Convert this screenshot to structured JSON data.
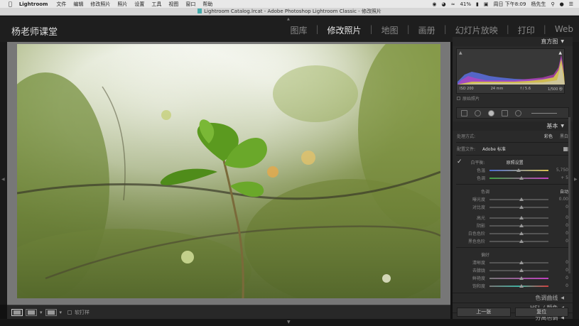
{
  "menubar": {
    "app_name": "Lightroom",
    "items": [
      "文件",
      "编辑",
      "修改照片",
      "照片",
      "设置",
      "工具",
      "视图",
      "窗口",
      "帮助"
    ],
    "battery": "41%",
    "clock": "周日 下午8:09",
    "user": "杨先生"
  },
  "window": {
    "title": "Lightroom Catalog.lrcat - Adobe Photoshop Lightroom Classic - 修改照片"
  },
  "header": {
    "brand": "杨老师课堂",
    "modules": [
      "图库",
      "修改照片",
      "地图",
      "画册",
      "幻灯片放映",
      "打印",
      "Web"
    ],
    "active_module": "修改照片"
  },
  "histogram": {
    "title": "直方图",
    "iso": "ISO 200",
    "focal": "24 mm",
    "aperture": "f / 5.6",
    "shutter": "1/500 秒",
    "original_photo": "原始照片"
  },
  "basic": {
    "title": "基本",
    "treatment_label": "处理方式:",
    "treatment_color": "彩色",
    "treatment_bw": "黑白",
    "profile_label": "配置文件:",
    "profile_value": "Adobe 标准",
    "wb_label": "白平衡:",
    "wb_value": "原照设置",
    "temp_label": "色温",
    "temp_value": "5,750",
    "tint_label": "色调",
    "tint_value": "+ 5",
    "tone_label": "色调",
    "auto": "自动",
    "exposure_label": "曝光度",
    "exposure_value": "0.00",
    "contrast_label": "对比度",
    "contrast_value": "0",
    "highlights_label": "高光",
    "highlights_value": "0",
    "shadows_label": "阴影",
    "shadows_value": "0",
    "whites_label": "白色色阶",
    "whites_value": "0",
    "blacks_label": "黑色色阶",
    "blacks_value": "0",
    "presence_label": "偏好",
    "texture_label": "清晰度",
    "texture_value": "0",
    "dehaze_label": "去朦胧",
    "dehaze_value": "0",
    "vibrance_label": "鲜艳度",
    "vibrance_value": "0",
    "saturation_label": "饱和度",
    "saturation_value": "0"
  },
  "collapsed_panels": [
    "色调曲线",
    "HSL / 颜色",
    "分离色调"
  ],
  "toolbar": {
    "softproof": "软打样"
  },
  "buttons": {
    "previous": "上一张",
    "reset": "复位"
  }
}
